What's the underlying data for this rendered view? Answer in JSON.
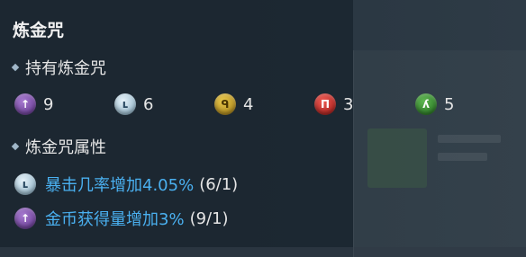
{
  "title": "炼金咒",
  "owned_section": "持有炼金咒",
  "attr_section": "炼金咒属性",
  "runes": [
    {
      "icon": "purple-arrow-rune-icon",
      "glyph": "↑",
      "count": "9"
    },
    {
      "icon": "white-hook-rune-icon",
      "glyph": "ʟ",
      "count": "6"
    },
    {
      "icon": "yellow-rune-icon",
      "glyph": "ᑫ",
      "count": "4"
    },
    {
      "icon": "red-rune-icon",
      "glyph": "Π",
      "count": "3"
    },
    {
      "icon": "green-rune-icon",
      "glyph": "ʎ",
      "count": "5"
    }
  ],
  "attributes": [
    {
      "icon": "white-hook-rune-icon",
      "glyph": "ʟ",
      "text": "暴击几率增加4.05%",
      "progress": "(6/1)"
    },
    {
      "icon": "purple-arrow-rune-icon",
      "glyph": "↑",
      "text": "金币获得量增加3%",
      "progress": "(9/1)"
    }
  ],
  "colors": {
    "attribute_text": "#4ab0f0",
    "background": "#1a242e"
  }
}
